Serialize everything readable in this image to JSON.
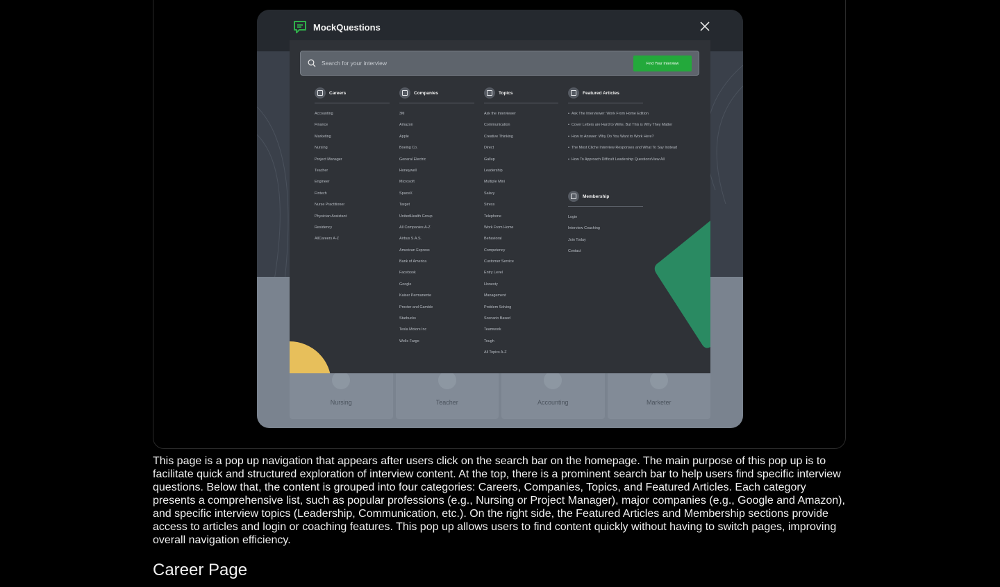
{
  "app": {
    "title": "MockQuestions"
  },
  "search": {
    "placeholder": "Search for your interview",
    "button_label": "Find Your Interview"
  },
  "columns": {
    "careers": {
      "title": "Careers",
      "items": [
        "Accounting",
        "Finance",
        "Marketing",
        "Nursing",
        "Project Manager",
        "Teacher",
        "Engineer",
        "Fintech",
        "Nurse Practitioner",
        "Physician Assistant",
        "Residency",
        "AllCareers A-Z"
      ]
    },
    "companies": {
      "title": "Companies",
      "items": [
        "3M",
        "Amazon",
        "Apple",
        "Boeing Co.",
        "General Electric",
        "Honeywell",
        "Microsoft",
        "SpaceX",
        "Target",
        "UnitedHealth Group",
        "All Companies A-Z",
        "Airbus S.A.S.",
        "American Express",
        "Bank of America",
        "Facebook",
        "Google",
        "Kaiser Permanente",
        "Procter and Gamble",
        "Starbucks",
        "Tesla Motors Inc",
        "Wells Fargo"
      ]
    },
    "topics": {
      "title": "Topics",
      "items": [
        "Ask the Interviewer",
        "Communication",
        "Creative Thinking",
        "Direct",
        "Gallup",
        "Leadership",
        "Multiple Mini",
        "Salary",
        "Stress",
        "Telephone",
        "Work From Home",
        "Behavioral",
        "Competency",
        "Customer Service",
        "Entry Level",
        "Honesty",
        "Management",
        "Problem Solving",
        "Scenario Based",
        "Teamwork",
        "Tough",
        "All Topics A-Z"
      ]
    },
    "featured": {
      "title": "Featured Articles",
      "items": [
        "Ask The Interviewer: Work From Home Edition",
        "Cover Letters are Hard to Write, But This is Why They Matter",
        "How to Answer: Why Do You Want to Work Here?",
        "The Most Cliche Interview Responses and What To Say Instead",
        "How To Approach Difficult Leadership QuestionsView All"
      ]
    },
    "membership": {
      "title": "Membership",
      "items": [
        "Login",
        "Interview Coaching",
        "Join Today",
        "Contact"
      ]
    }
  },
  "background_cards": [
    "Nursing",
    "Teacher",
    "Accounting",
    "Marketer"
  ],
  "caption": "This page is a pop up navigation that appears after users click on the search bar on the homepage. The main purpose of this pop up is to facilitate quick and structured exploration of interview content. At the top, there is a prominent search bar to help users find specific interview questions. Below that, the content is grouped into four categories: Careers, Companies, Topics, and Featured Articles. Each category presents a comprehensive list, such as popular professions (e.g., Nursing or Project Manager), major companies (e.g., Google and Amazon), and specific interview topics (Leadership, Communication, etc.). On the right side, the Featured Articles and Membership sections provide access to articles and login or coaching features. This pop up allows users to find content quickly without having to switch pages, improving overall navigation efficiency.",
  "section_title": "Career Page",
  "colors": {
    "accent_green": "#23a93b",
    "shape_green": "#2a8a62",
    "shape_yellow": "#e7bf5b"
  }
}
